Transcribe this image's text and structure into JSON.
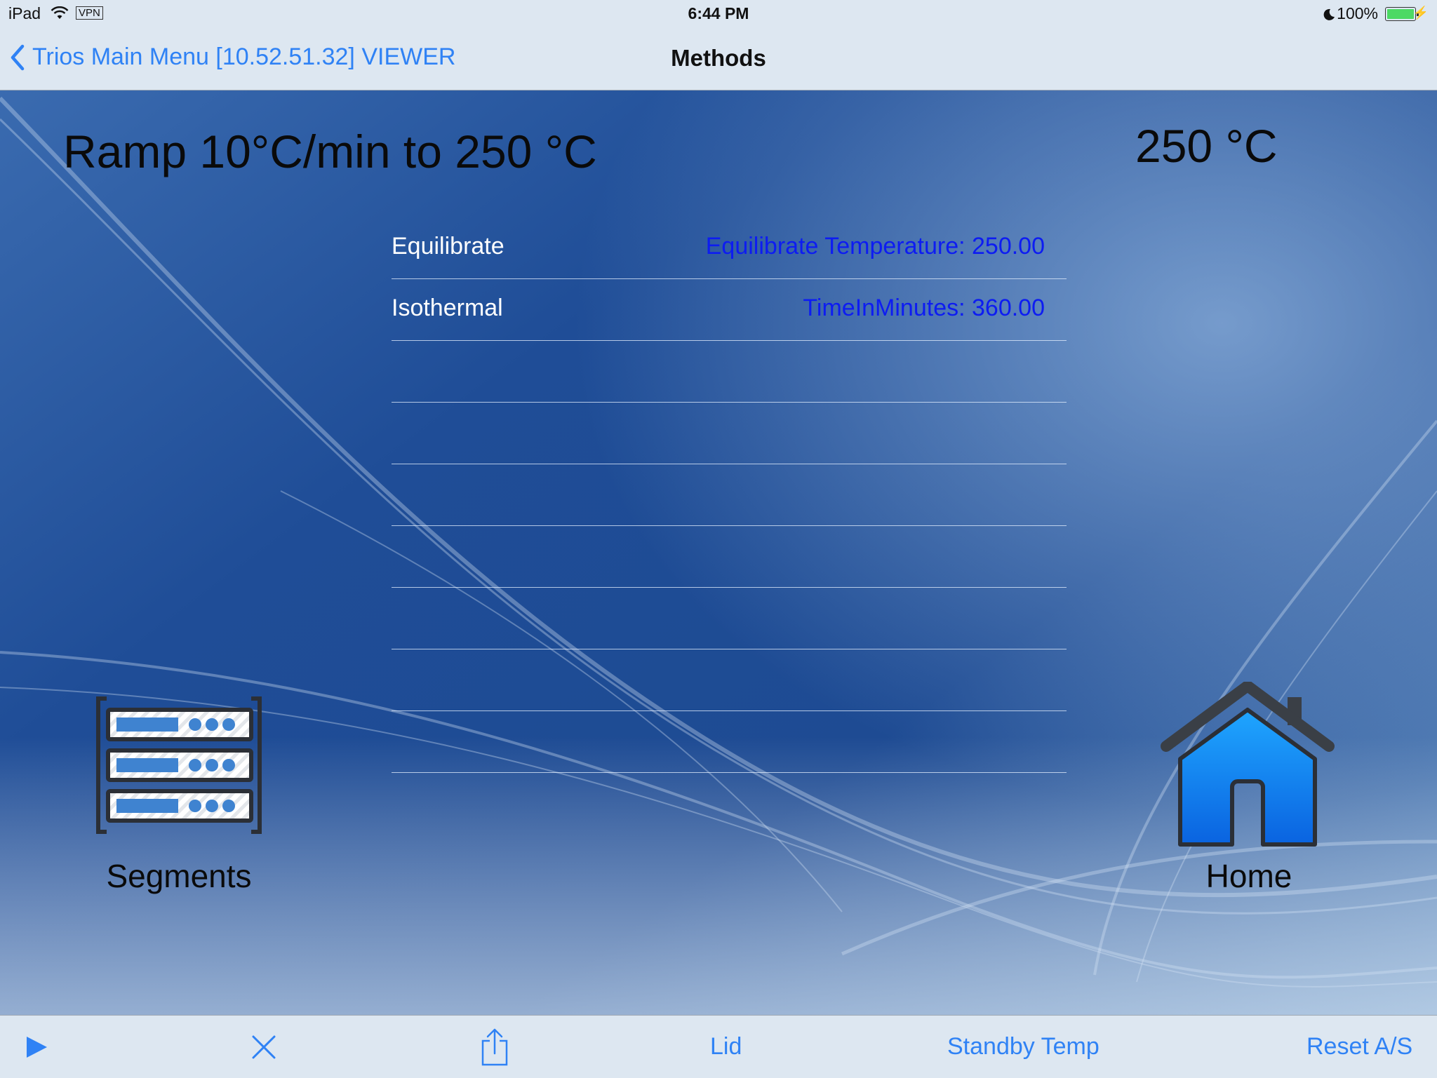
{
  "status_bar": {
    "device": "iPad",
    "vpn": "VPN",
    "time": "6:44 PM",
    "battery": "100%",
    "battery_level": 1.0,
    "icons": [
      "wifi-icon",
      "moon-icon",
      "battery-icon",
      "charging-bolt-icon"
    ]
  },
  "nav": {
    "back_label": "Trios Main Menu [10.52.51.32] VIEWER",
    "title": "Methods"
  },
  "main": {
    "segment_title": "Ramp 10°C/min to 250 °C",
    "temperature": "250 °C",
    "method_rows": [
      {
        "name": "Equilibrate",
        "value": "Equilibrate Temperature: 250.00"
      },
      {
        "name": "Isothermal",
        "value": "TimeInMinutes: 360.00"
      },
      {
        "name": "",
        "value": ""
      },
      {
        "name": "",
        "value": ""
      },
      {
        "name": "",
        "value": ""
      },
      {
        "name": "",
        "value": ""
      },
      {
        "name": "",
        "value": ""
      },
      {
        "name": "",
        "value": ""
      },
      {
        "name": "",
        "value": ""
      }
    ],
    "segments_label": "Segments",
    "home_label": "Home"
  },
  "toolbar": {
    "play_icon": "play-icon",
    "stop_icon": "close-icon",
    "share_icon": "share-icon",
    "lid_label": "Lid",
    "standby_label": "Standby Temp",
    "reset_label": "Reset A/S"
  },
  "colors": {
    "accent": "#2f82f5",
    "value_text": "#0d1cf2",
    "bar_background": "#dde7f1",
    "background": "#1f4f96"
  }
}
